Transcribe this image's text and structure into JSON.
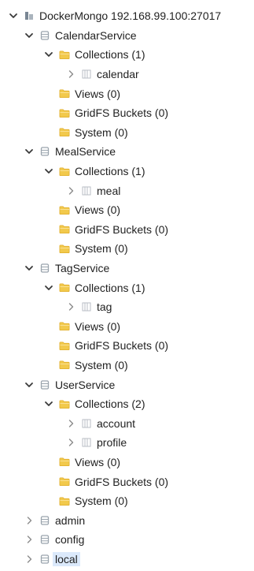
{
  "connection": {
    "label": "DockerMongo 192.168.99.100:27017",
    "icon": "server-icon"
  },
  "databases": [
    {
      "name": "CalendarService",
      "expanded": true,
      "collections_label": "Collections (1)",
      "collections": [
        "calendar"
      ],
      "views_label": "Views (0)",
      "gridfs_label": "GridFS Buckets (0)",
      "system_label": "System (0)"
    },
    {
      "name": "MealService",
      "expanded": true,
      "collections_label": "Collections (1)",
      "collections": [
        "meal"
      ],
      "views_label": "Views (0)",
      "gridfs_label": "GridFS Buckets (0)",
      "system_label": "System (0)"
    },
    {
      "name": "TagService",
      "expanded": true,
      "collections_label": "Collections (1)",
      "collections": [
        "tag"
      ],
      "views_label": "Views (0)",
      "gridfs_label": "GridFS Buckets (0)",
      "system_label": "System (0)"
    },
    {
      "name": "UserService",
      "expanded": true,
      "collections_label": "Collections (2)",
      "collections": [
        "account",
        "profile"
      ],
      "views_label": "Views (0)",
      "gridfs_label": "GridFS Buckets (0)",
      "system_label": "System (0)"
    },
    {
      "name": "admin",
      "expanded": false
    },
    {
      "name": "config",
      "expanded": false
    },
    {
      "name": "local",
      "expanded": false,
      "selected": true
    }
  ],
  "colors": {
    "folder": "#f2c94c",
    "folder_dark": "#e0ad2a",
    "database": "#9aa4ad",
    "collection": "#b8bec4",
    "server": "#7a8794",
    "chevron": "#3a3a3a",
    "selection": "#dbe9fb"
  }
}
